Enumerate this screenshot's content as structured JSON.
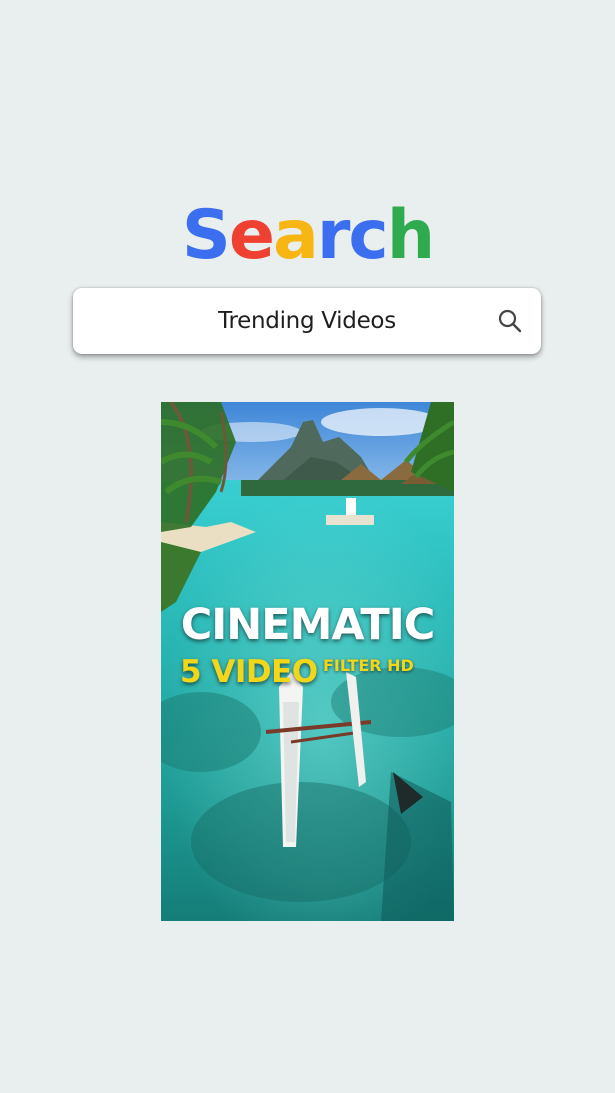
{
  "logo": {
    "letters": [
      "S",
      "e",
      "a",
      "r",
      "c",
      "h"
    ],
    "colors": [
      "#3b6ff0",
      "#ee4131",
      "#f7b614",
      "#3b6ff0",
      "#3b6ff0",
      "#2faa4e"
    ]
  },
  "search": {
    "query": "Trending Videos",
    "icon": "search-icon"
  },
  "video": {
    "title_main": "CINEMATIC",
    "title_sub": "5 VIDEO",
    "title_sub2": "FILTER HD"
  }
}
